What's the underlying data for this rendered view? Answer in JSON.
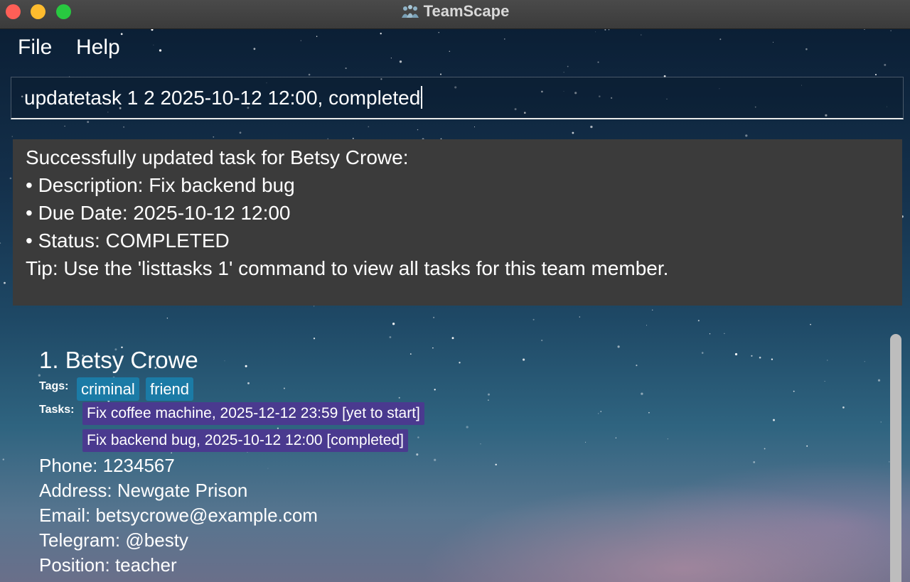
{
  "window": {
    "title": "TeamScape",
    "app_icon": "people-icon",
    "controls": [
      "close",
      "minimize",
      "maximize"
    ]
  },
  "menu": {
    "file": "File",
    "help": "Help"
  },
  "command_box": {
    "value": "updatetask 1 2 2025-10-12 12:00, completed"
  },
  "result": {
    "lines": [
      "Successfully updated task for Betsy Crowe:",
      "• Description: Fix backend bug",
      "• Due Date: 2025-10-12 12:00",
      "• Status: COMPLETED",
      "Tip: Use the 'listtasks 1' command to view all tasks for this team member."
    ]
  },
  "person": {
    "name": "1. Betsy Crowe",
    "tags_label": "Tags:",
    "tags": [
      "criminal",
      "friend"
    ],
    "tasks_label": "Tasks:",
    "tasks": [
      "Fix coffee machine, 2025-12-12 23:59 [yet to start]",
      "Fix backend bug, 2025-10-12 12:00 [completed]"
    ],
    "phone": "Phone: 1234567",
    "address": "Address: Newgate Prison",
    "email": "Email: betsycrowe@example.com",
    "telegram": "Telegram: @besty",
    "position": "Position: teacher"
  },
  "colors": {
    "tag": "#1b7ba6",
    "task": "#4a3a8f",
    "result_bg": "#3b3b3b"
  }
}
